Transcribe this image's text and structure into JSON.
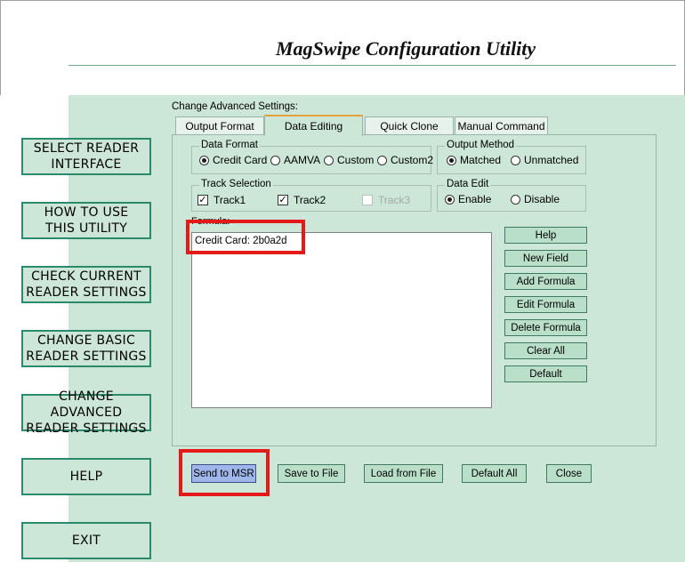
{
  "app": {
    "title": "MagSwipe Configuration Utility"
  },
  "nav": {
    "items": [
      {
        "label": "SELECT READER\nINTERFACE"
      },
      {
        "label": "HOW TO USE\nTHIS UTILITY"
      },
      {
        "label": "CHECK CURRENT\nREADER SETTINGS"
      },
      {
        "label": "CHANGE BASIC\nREADER SETTINGS"
      },
      {
        "label": "CHANGE ADVANCED\nREADER SETTINGS"
      },
      {
        "label": "HELP"
      },
      {
        "label": "EXIT"
      }
    ]
  },
  "settings": {
    "label": "Change Advanced Settings:",
    "tabs": [
      {
        "label": "Output Format",
        "active": false
      },
      {
        "label": "Data Editing",
        "active": true
      },
      {
        "label": "Quick Clone",
        "active": false
      },
      {
        "label": "Manual Command",
        "active": false
      }
    ],
    "data_format": {
      "title": "Data Format",
      "options": [
        "Credit Card",
        "AAMVA",
        "Custom",
        "Custom2"
      ],
      "selected": "Credit Card"
    },
    "output_method": {
      "title": "Output Method",
      "options": [
        "Matched",
        "Unmatched"
      ],
      "selected": "Matched"
    },
    "track_selection": {
      "title": "Track Selection",
      "tracks": [
        {
          "label": "Track1",
          "checked": true,
          "enabled": true
        },
        {
          "label": "Track2",
          "checked": true,
          "enabled": true
        },
        {
          "label": "Track3",
          "checked": false,
          "enabled": false
        }
      ]
    },
    "data_edit": {
      "title": "Data Edit",
      "options": [
        "Enable",
        "Disable"
      ],
      "selected": "Enable"
    },
    "formula": {
      "label": "Formula:",
      "value": "Credit Card: 2b0a2d"
    },
    "side_buttons": [
      "Help",
      "New Field",
      "Add Formula",
      "Edit Formula",
      "Delete Formula",
      "Clear All",
      "Default"
    ]
  },
  "bottom_buttons": {
    "send": "Send to MSR",
    "save": "Save to File",
    "load": "Load from File",
    "default_all": "Default All",
    "close": "Close"
  },
  "colors": {
    "panel_bg": "#cce6d7",
    "nav_border": "#2a8a6d",
    "highlight": "#e61919",
    "active_tab_accent": "#e5a23a"
  }
}
